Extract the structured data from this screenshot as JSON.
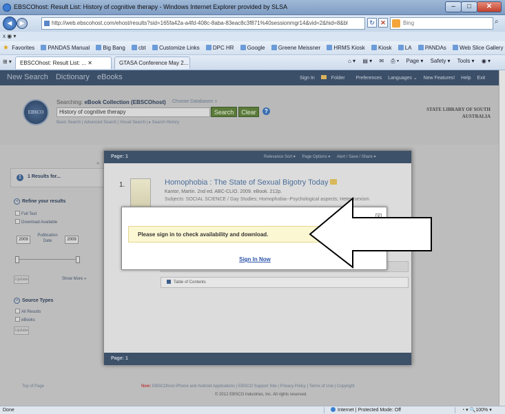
{
  "window": {
    "title": "EBSCOhost: Result List: History of cognitive therapy - Windows Internet Explorer provided by SLSA",
    "minimize": "–",
    "maximize": "□",
    "close": "✕"
  },
  "address_bar": {
    "url": "http://web.ebscohost.com/ehost/results?sid=165fa42a-a4fd-408c-8aba-83eac8c3f871%40sessionmgr14&vid=2&hid=8&bl",
    "search_placeholder": "Bing",
    "back": "◄",
    "forward": "►"
  },
  "menu_bar": {
    "text": "x  ◉ ▾"
  },
  "favorites_bar": {
    "label": "Favorites",
    "items": [
      "PANDAS Manual",
      "Big Bang",
      "cbt",
      "Customize Links",
      "DPC HR",
      "Google",
      "Greene Meissner",
      "HRMS Kiosk",
      "Kiosk",
      "LA",
      "PANDAs",
      "Web Slice Gallery ▾"
    ]
  },
  "tabs": [
    {
      "label": "EBSCOhost: Result List: ... ✕"
    },
    {
      "label": "GTASA Conference May 2..."
    }
  ],
  "command_bar": {
    "items": [
      "Page ▾",
      "Safety ▾",
      "Tools ▾",
      "◉ ▾"
    ]
  },
  "ebsco": {
    "top_nav": [
      "New Search",
      "Dictionary",
      "eBooks"
    ],
    "top_links": [
      "Sign In",
      "Folder",
      "Preferences",
      "Languages ⌄",
      "New Features!",
      "Help",
      "Exit"
    ],
    "logo_text": "EBSCO",
    "searching_prefix": "Searching: ",
    "searching_db": "eBook Collection (EBSCOhost)",
    "choose_db": "Choose Databases »",
    "search_query": "History of cognitive therapy",
    "search_button": "Search",
    "clear_button": "Clear",
    "help_icon": "?",
    "search_links": "Basic Search  |  Advanced Search  |  Visual Search  |  ▸ Search History",
    "library_name": "STATE LIBRARY OF SOUTH AUSTRALIA",
    "sidebar": {
      "results_count": "1",
      "results_for": "1 Results for...",
      "refine_label": "Refine your results",
      "full_text": "Full Text",
      "download_available": "Download Available",
      "pub_from": "2009",
      "pub_label": "Publication Date",
      "pub_to": "2009",
      "update_btn": "Update",
      "show_more": "Show More »",
      "source_types_label": "Source Types",
      "all_results": "All Results",
      "ebooks": "eBooks",
      "update_btn2": "Update",
      "collapse": "«"
    },
    "results": {
      "page_label": "Page: 1",
      "options": [
        "Relevance Sort ▾",
        "Page Options ▾",
        "Alert / Save / Share ▾"
      ],
      "result_number": "1.",
      "title": "Homophobia : The State of Sexual Bigotry Today",
      "meta": "Kantor, Martin. 2nd ed. ABC-CLIO. 2009. eBook. 212p.",
      "subjects": "Subjects: SOCIAL SCIENCE / Gay Studies; Homophobia--Psychological aspects; Heterosexism",
      "toc": "Table of Contents",
      "footer_page_label": "Page: 1"
    },
    "footer": {
      "top_of_page": "Top of Page",
      "new_label": "New:",
      "links": "EBSCOhost iPhone and Android Applications  |  EBSCO Support Site  |  Privacy Policy  |  Terms of Use  |  Copyright",
      "copyright": "© 2012 EBSCO Industries, Inc. All rights reserved."
    }
  },
  "modal": {
    "message": "Please sign in to check availability and download.",
    "sign_in_link": "Sign In Now",
    "close": "x"
  },
  "status_bar": {
    "status": "Done",
    "zone": "Internet | Protected Mode: Off",
    "zoom": "◔ ▾  🔍100% ▾"
  },
  "colors": {
    "ebsco_nav": "#3b4f68",
    "modal_message_bg": "#fcf7d3",
    "link": "#2a52a8",
    "arrow_stroke": "#000000"
  }
}
